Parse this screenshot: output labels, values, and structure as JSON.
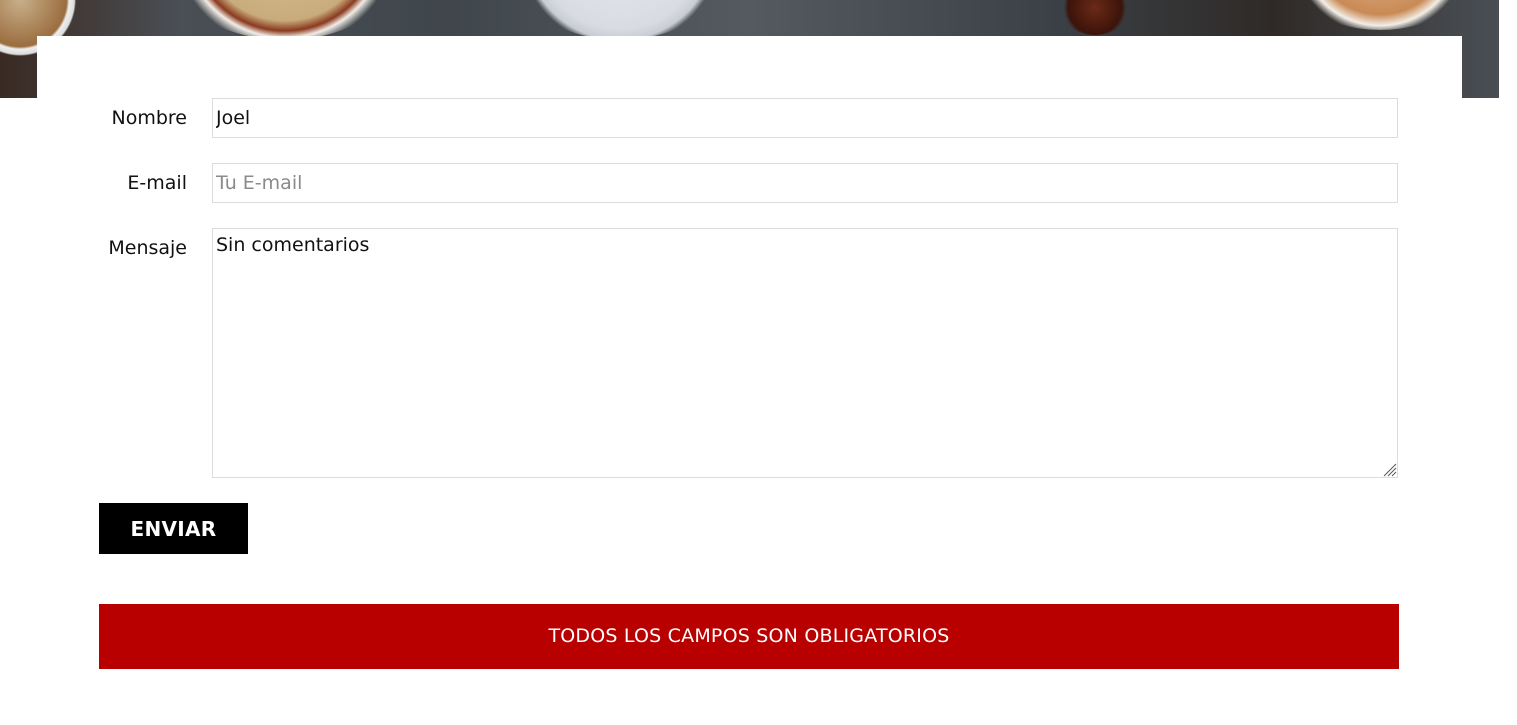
{
  "form": {
    "name_label": "Nombre",
    "name_value": "Joel",
    "email_label": "E-mail",
    "email_placeholder": "Tu E-mail",
    "message_label": "Mensaje",
    "message_value": "Sin comentarios",
    "submit_label": "ENVIAR"
  },
  "notice": {
    "text": "TODOS LOS CAMPOS SON OBLIGATORIOS"
  },
  "colors": {
    "button_bg": "#000000",
    "notice_bg": "#b80000",
    "field_border": "#dcdcdc"
  }
}
